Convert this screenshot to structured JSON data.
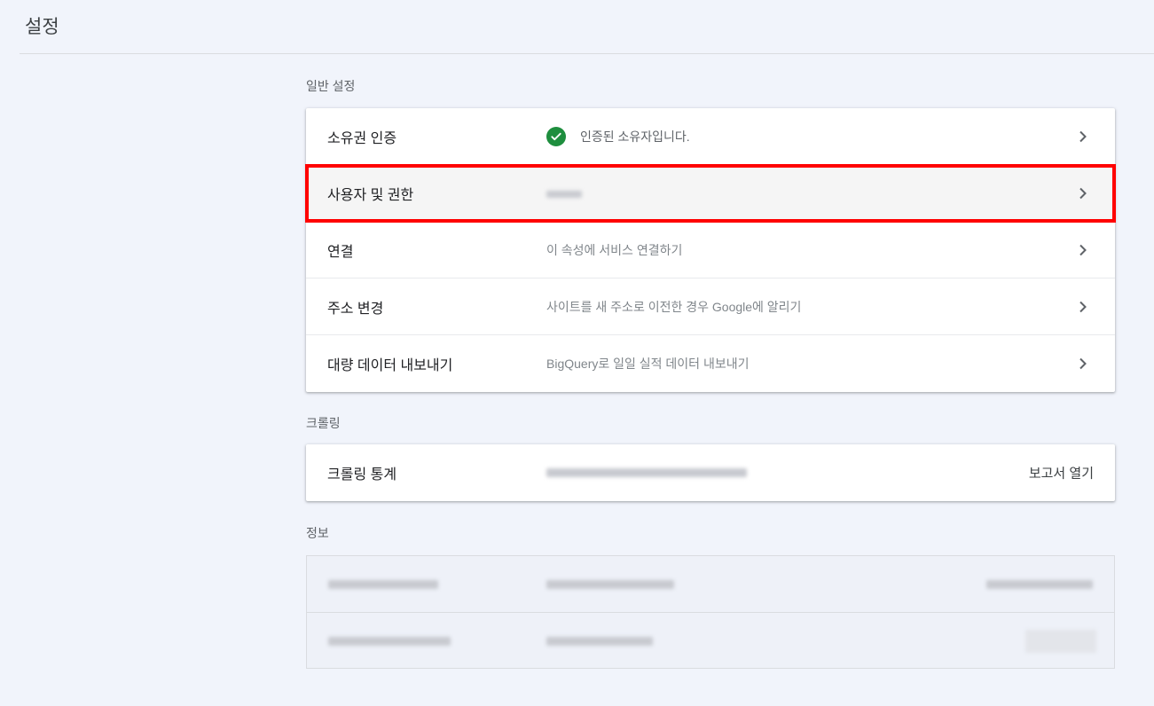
{
  "page": {
    "title": "설정"
  },
  "general": {
    "label": "일반 설정",
    "rows": [
      {
        "title": "소유권 인증",
        "desc": "인증된 소유자입니다."
      },
      {
        "title": "사용자 및 권한",
        "desc": ""
      },
      {
        "title": "연결",
        "desc": "이 속성에 서비스 연결하기"
      },
      {
        "title": "주소 변경",
        "desc": "사이트를 새 주소로 이전한 경우 Google에 알리기"
      },
      {
        "title": "대량 데이터 내보내기",
        "desc": "BigQuery로 일일 실적 데이터 내보내기"
      }
    ]
  },
  "crawling": {
    "label": "크롤링",
    "rows": [
      {
        "title": "크롤링 통계",
        "action": "보고서 열기"
      }
    ]
  },
  "info": {
    "label": "정보"
  },
  "icons": {
    "verified": "check-circle-icon",
    "navigate": "chevron-right-icon"
  },
  "colors": {
    "background": "#f1f4fb",
    "verified_green": "#1e8e3e",
    "highlight_border": "#ff0000"
  }
}
